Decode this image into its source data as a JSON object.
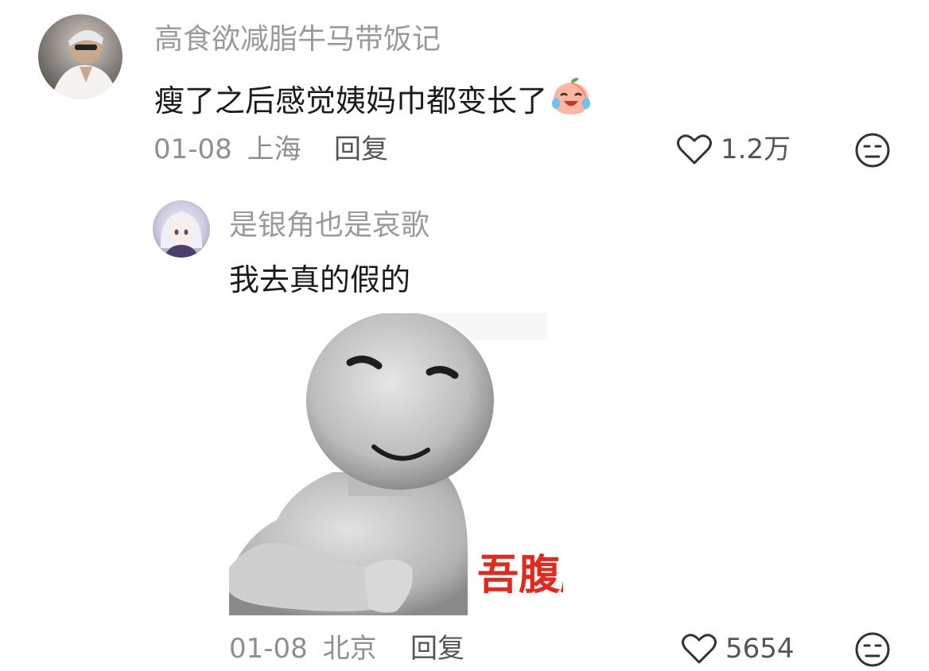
{
  "comment": {
    "username": "高食欲减脂牛马带饭记",
    "text": "瘦了之后感觉姨妈巾都变长了",
    "emoji": "peach-crying-laughing-emoji",
    "date": "01-08",
    "location": "上海",
    "reply_label": "回复",
    "likes": "1.2万"
  },
  "reply": {
    "username": "是银角也是哀歌",
    "text": "我去真的假的",
    "sticker_caption": "吾腹腹",
    "date": "01-08",
    "location": "北京",
    "reply_label": "回复",
    "likes": "5654"
  },
  "icons": {
    "like": "heart-outline-icon",
    "dislike": "neutral-face-icon"
  }
}
